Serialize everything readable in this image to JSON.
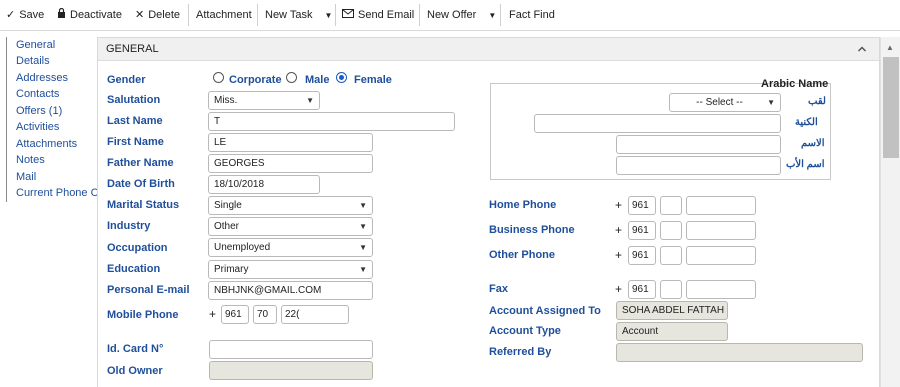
{
  "toolbar": {
    "save": "Save",
    "deactivate": "Deactivate",
    "delete": "Delete",
    "attachment": "Attachment",
    "new_task": "New Task",
    "send_email": "Send Email",
    "new_offer": "New Offer",
    "fact_find": "Fact Find"
  },
  "sidebar": {
    "items": [
      "General",
      "Details",
      "Addresses",
      "Contacts",
      "Offers (1)",
      "Activities",
      "Attachments",
      "Notes",
      "Mail",
      "Current Phone Call"
    ]
  },
  "panel": {
    "title": "GENERAL"
  },
  "form": {
    "gender_label": "Gender",
    "gender_options": [
      "Corporate",
      "Male",
      "Female"
    ],
    "gender_selected": "Female",
    "salutation_label": "Salutation",
    "salutation_value": "Miss.",
    "last_name_label": "Last Name",
    "last_name_value": "T",
    "first_name_label": "First Name",
    "first_name_value": "LE",
    "father_name_label": "Father Name",
    "father_name_value": "GEORGES",
    "dob_label": "Date Of Birth",
    "dob_value": "18/10/2018",
    "marital_label": "Marital Status",
    "marital_value": "Single",
    "industry_label": "Industry",
    "industry_value": "Other",
    "occupation_label": "Occupation",
    "occupation_value": "Unemployed",
    "education_label": "Education",
    "education_value": "Primary",
    "email_label": "Personal E-mail",
    "email_value": "NBHJNK@GMAIL.COM",
    "mobile_label": "Mobile Phone",
    "mobile_plus": "+",
    "mobile_country": "961",
    "mobile_area": "70",
    "mobile_number": "22(",
    "id_card_label": "Id. Card N°",
    "id_card_value": "",
    "old_owner_label": "Old Owner",
    "old_owner_value": ""
  },
  "arabic": {
    "title": "Arabic Name",
    "laqab_label": "لقب",
    "laqab_value": "-- Select --",
    "kunya_label": "الكنية",
    "ism_label": "الاسم",
    "ism_ab_label": "اسم الأب"
  },
  "right": {
    "home_phone_label": "Home Phone",
    "business_phone_label": "Business Phone",
    "other_phone_label": "Other Phone",
    "fax_label": "Fax",
    "plus": "+",
    "country_code": "961",
    "account_assigned_label": "Account Assigned To",
    "account_assigned_value": "SOHA ABDEL FATTAH",
    "account_type_label": "Account Type",
    "account_type_value": "Account",
    "referred_by_label": "Referred By",
    "referred_by_value": ""
  }
}
